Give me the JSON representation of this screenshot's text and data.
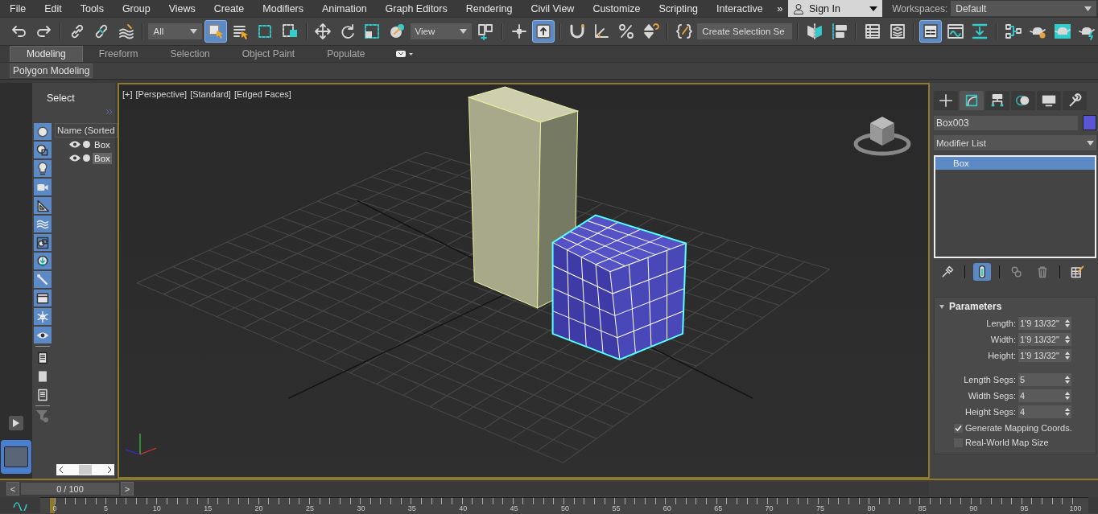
{
  "menu_bar": {
    "items": [
      "File",
      "Edit",
      "Tools",
      "Group",
      "Views",
      "Create",
      "Modifiers",
      "Animation",
      "Graph Editors",
      "Rendering",
      "Civil View",
      "Customize",
      "Scripting",
      "Interactive"
    ],
    "overflow": "»",
    "sign_in": "Sign In",
    "workspaces_label": "Workspaces:",
    "workspace": "Default"
  },
  "main_toolbar": {
    "items": [
      {
        "kind": "undo",
        "on": false
      },
      {
        "kind": "redo",
        "on": false
      },
      {
        "kind": "separator"
      },
      {
        "kind": "link",
        "on": false
      },
      {
        "kind": "unlink",
        "on": false
      },
      {
        "kind": "bind",
        "on": false
      },
      {
        "kind": "separator"
      },
      {
        "kind": "dropdown",
        "value": "All"
      },
      {
        "kind": "select",
        "on": true
      },
      {
        "kind": "select-by-name",
        "on": false
      },
      {
        "kind": "rect-region",
        "on": false
      },
      {
        "kind": "window-crossing",
        "on": false
      },
      {
        "kind": "separator"
      },
      {
        "kind": "move",
        "on": false
      },
      {
        "kind": "rotate",
        "on": false
      },
      {
        "kind": "scale",
        "on": false
      },
      {
        "kind": "placement",
        "on": false
      },
      {
        "kind": "dropdown",
        "value": "View"
      },
      {
        "kind": "pivot",
        "on": false
      },
      {
        "kind": "separator"
      },
      {
        "kind": "manipulate",
        "on": false
      },
      {
        "kind": "keyboard",
        "on": true
      },
      {
        "kind": "separator"
      },
      {
        "kind": "snap",
        "on": false
      },
      {
        "kind": "angle-snap",
        "on": false
      },
      {
        "kind": "percent-snap",
        "on": false
      },
      {
        "kind": "spinner-snap",
        "on": false
      },
      {
        "kind": "separator"
      },
      {
        "kind": "named-selection",
        "on": false
      },
      {
        "kind": "dropdown",
        "value": "Create Selection Se"
      },
      {
        "kind": "separator"
      },
      {
        "kind": "mirror",
        "on": false
      },
      {
        "kind": "align",
        "on": false
      },
      {
        "kind": "separator"
      },
      {
        "kind": "scene-explorer",
        "on": false
      },
      {
        "kind": "layers",
        "on": false
      },
      {
        "kind": "separator"
      },
      {
        "kind": "ribbon",
        "on": true
      },
      {
        "kind": "curve-editor",
        "on": false
      },
      {
        "kind": "schematic",
        "on": false
      },
      {
        "kind": "separator"
      },
      {
        "kind": "material-editor",
        "on": false
      },
      {
        "kind": "render-setup",
        "on": false
      },
      {
        "kind": "rendered-frame",
        "on": false
      },
      {
        "kind": "render",
        "on": false
      }
    ]
  },
  "ribbon": {
    "tabs": [
      {
        "label": "Modeling",
        "selected": true
      },
      {
        "label": "Freeform",
        "selected": false
      },
      {
        "label": "Selection",
        "selected": false
      },
      {
        "label": "Object Paint",
        "selected": false
      },
      {
        "label": "Populate",
        "selected": false
      }
    ],
    "panel": "Polygon Modeling"
  },
  "scene_explorer": {
    "title": "Select",
    "column": "Name (Sorted",
    "filters": [
      {
        "kind": "geometry",
        "on": true
      },
      {
        "kind": "shapes",
        "on": true
      },
      {
        "kind": "lights",
        "on": true
      },
      {
        "kind": "cameras",
        "on": true
      },
      {
        "kind": "helpers",
        "on": true
      },
      {
        "kind": "spacewarps",
        "on": true
      },
      {
        "kind": "groups",
        "on": true
      },
      {
        "kind": "xrefs",
        "on": true
      },
      {
        "kind": "bones",
        "on": true
      },
      {
        "kind": "containers",
        "on": true
      },
      {
        "kind": "frozen",
        "on": true
      },
      {
        "kind": "hidden",
        "on": true
      },
      {
        "kind": "display-all",
        "on": false
      },
      {
        "kind": "display-none",
        "on": false
      },
      {
        "kind": "invert",
        "on": false
      }
    ],
    "rows": [
      {
        "name": "Box",
        "selected": false
      },
      {
        "name": "Box",
        "selected": true
      }
    ]
  },
  "viewport": {
    "labels": [
      "[+]",
      "[Perspective]",
      "[Standard]",
      "[Edged Faces]"
    ]
  },
  "command_panel": {
    "tabs": [
      {
        "kind": "create",
        "selected": false
      },
      {
        "kind": "modify",
        "selected": true
      },
      {
        "kind": "hierarchy",
        "selected": false
      },
      {
        "kind": "motion",
        "selected": false
      },
      {
        "kind": "display",
        "selected": false
      },
      {
        "kind": "utilities",
        "selected": false
      }
    ],
    "object_name": "Box003",
    "modifier_list": "Modifier List",
    "stack": [
      {
        "label": "Box",
        "selected": true
      }
    ],
    "stack_buttons": [
      {
        "kind": "pin",
        "on": false
      },
      {
        "kind": "end-result",
        "on": true
      },
      {
        "kind": "make-unique",
        "on": false
      },
      {
        "kind": "remove",
        "on": false
      },
      {
        "kind": "configure",
        "on": false
      }
    ],
    "rollout": {
      "title": "Parameters",
      "expanded": true,
      "fields": [
        {
          "label": "Length:",
          "value": "1'9 13/32\""
        },
        {
          "label": "Width:",
          "value": "1'9 13/32\""
        },
        {
          "label": "Height:",
          "value": "1'9 13/32\""
        },
        {
          "label": "Length Segs:",
          "value": "5"
        },
        {
          "label": "Width Segs:",
          "value": "4"
        },
        {
          "label": "Height Segs:",
          "value": "4"
        }
      ],
      "checkboxes": [
        {
          "label": "Generate Mapping Coords.",
          "checked": true
        },
        {
          "label": "Real-World Map Size",
          "checked": false
        }
      ]
    }
  },
  "time_slider": {
    "prev": "<",
    "value": "0 / 100",
    "level": 0,
    "next": ">"
  },
  "track_bar": {
    "labels": [
      "0",
      "5",
      "10",
      "15",
      "20",
      "25",
      "30",
      "35",
      "40",
      "45",
      "50",
      "55",
      "60",
      "65",
      "70",
      "75",
      "80",
      "85",
      "90",
      "95",
      "100"
    ]
  }
}
